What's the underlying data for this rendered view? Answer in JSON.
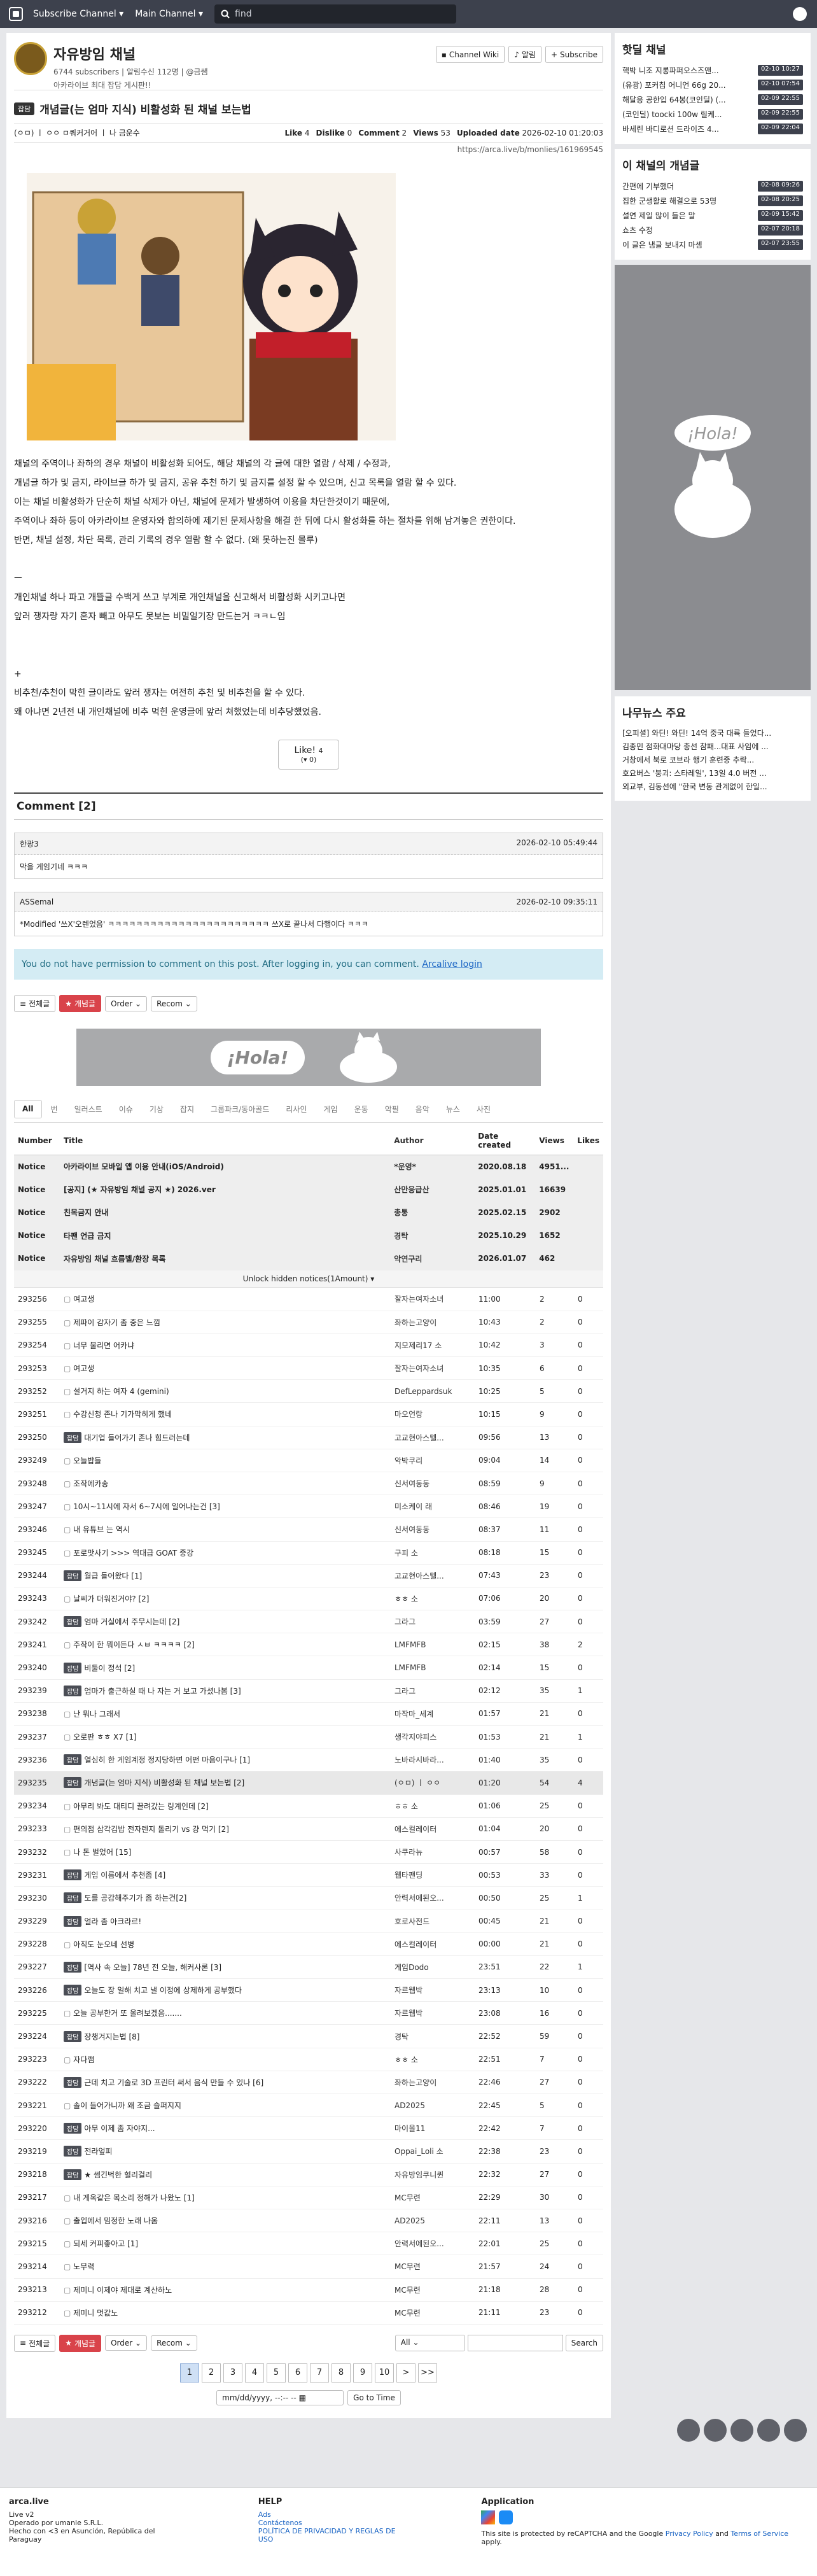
{
  "topbar": {
    "subscribe": "Subscribe Channel ▾",
    "main": "Main Channel ▾",
    "search_placeholder": "find"
  },
  "channel": {
    "name": "자유방임 채널",
    "subscribers": "6744 subscribers",
    "notify": "알림수신 112명",
    "owner": "@금쌤",
    "desc": "아카라이브 최대 잡담 게시판!!",
    "btn_wiki": "Channel Wiki",
    "btn_notify": "알림",
    "btn_subscribe": "Subscribe"
  },
  "article": {
    "badge": "잡담",
    "title": "개념글(는 엄마 지식) 비활성화 된 채널 보는법",
    "author": "(ㅇㅁ) ㅣ ㅇㅇ ㅁ쿼커거어 ㅣ 나 금운수",
    "like_label": "Like",
    "like": "4",
    "dislike_label": "Dislike",
    "dislike": "0",
    "comment_label": "Comment",
    "comment": "2",
    "views_label": "Views",
    "views": "53",
    "uploaded_label": "Uploaded date",
    "uploaded": "2026-02-10 01:20:03",
    "url": "https://arca.live/b/monlies/161969545",
    "body": [
      "채널의 주역이나 좌하의 경우 채널이 비활성화 되어도, 해당 채널의 각 글에 대한 열람 / 삭제 / 수정과,",
      "개념글 하가 및 금지, 라이브글 하가 및 금지, 공유 추천 하기 및 금지를 설정 할 수 있으며, 신고 목록을 열람 할 수 있다.",
      "이는 채널 비활성화가 단순히 채널 삭제가 아닌, 채널에 문제가 발생하여 이용을 차단한것이기 때문에,",
      "주역이나 좌하 등이 아카라이브 운영자와 합의하에 제기된 문제사항을 해결 한 뒤에 다시 활성화를 하는 절차를 위해 남겨놓은 권한이다.",
      "반면, 채널 설정, 차단 목록, 관리 기록의 경우 열람 할 수 없다. (왜 못하는진 몰루)",
      "",
      "ㅡ",
      "개인채널 하나 파고 개뜰글 수백게 쓰고 부계로 개인채널을 신고해서 비활성화 시키고나면",
      "앞러 쟁자랑 자기 혼자 빼고 아무도 못보는 비밀일기장 만드는거 ㅋㅋㄴ임",
      "",
      "",
      "+",
      "비추천/추천이 막힌 글이라도 앞러 쟁자는 여전히 추천 및 비추천을 할 수 있다.",
      "왜 아냐면 2년전 내 개인채널에 비추 먹힌 운영글에 앞러 쳐했었는데 비추당했었음."
    ],
    "like_btn": "Like!",
    "like_count": "4",
    "like_sub": "0"
  },
  "comments": {
    "heading": "Comment [2]",
    "items": [
      {
        "author": "한광3",
        "date": "2026-02-10 05:49:44",
        "text": "막을 게임기네 ㅋㅋㅋ"
      },
      {
        "author": "ASSemal",
        "date": "2026-02-10 09:35:11",
        "text": "*Modified '쓰X'오렌었음' ㅋㅋㅋㅋㅋㅋㅋㅋㅋㅋㅋㅋㅋㅋㅋㅋㅋㅋㅋㅋㅋㅋㅋ 쓰X로 끝나서 다행이다 ㅋㅋㅋ"
      }
    ],
    "no_permission": "You do not have permission to comment on this post. After logging in, you can comment.",
    "login": "Arcalive login"
  },
  "controls": {
    "all": "전체글",
    "best": "개념글",
    "order": "Order",
    "recom": "Recom"
  },
  "ad": {
    "hola": "¡Hola!"
  },
  "categories": [
    "All",
    "번",
    "일러스트",
    "이슈",
    "기상",
    "잡지",
    "그룹파크/동아골드",
    "리사인",
    "게임",
    "운동",
    "악필",
    "음악",
    "뉴스",
    "사진"
  ],
  "board": {
    "headers": {
      "num": "Number",
      "title": "Title",
      "author": "Author",
      "date": "Date created",
      "views": "Views",
      "rec": "Likes"
    },
    "notices": [
      {
        "num": "Notice",
        "title": "아카라이브 모바일 앱 이용 안내(iOS/Android)",
        "author": "*운영*",
        "date": "2020.08.18",
        "views": "4951...",
        "rec": ""
      },
      {
        "num": "Notice",
        "title": "[공지] (★ 자유방임 채널 공지 ★) 2026.ver",
        "author": "산만응급산",
        "date": "2025.01.01",
        "views": "16639",
        "rec": ""
      },
      {
        "num": "Notice",
        "title": "친목금지 안내",
        "author": "총통",
        "date": "2025.02.15",
        "views": "2902",
        "rec": ""
      },
      {
        "num": "Notice",
        "title": "타팬 언급 금지",
        "author": "경탁",
        "date": "2025.10.29",
        "views": "1652",
        "rec": ""
      },
      {
        "num": "Notice",
        "title": "자유방임 채널 흐름벨/환장 목록",
        "author": "악연구리",
        "date": "2026.01.07",
        "views": "462",
        "rec": ""
      }
    ],
    "unlock": "Unlock hidden notices(1Amount)",
    "rows": [
      {
        "num": "293256",
        "tag": "",
        "title": "여고생",
        "author": "잘자는여자소녀",
        "date": "11:00",
        "views": "2",
        "rec": "0"
      },
      {
        "num": "293255",
        "tag": "",
        "title": "제파이 감자기 좀 중은 느낌",
        "author": "좌하는고양이",
        "date": "10:43",
        "views": "2",
        "rec": "0"
      },
      {
        "num": "293254",
        "tag": "",
        "title": "너무 불리면 어카냐",
        "author": "지모제리17 소",
        "date": "10:42",
        "views": "3",
        "rec": "0"
      },
      {
        "num": "293253",
        "tag": "",
        "title": "여고생",
        "author": "잘자는여자소녀",
        "date": "10:35",
        "views": "6",
        "rec": "0"
      },
      {
        "num": "293252",
        "tag": "",
        "title": "설거지 하는 여자 4 (gemini)",
        "author": "DefLeppardsuk",
        "date": "10:25",
        "views": "5",
        "rec": "0"
      },
      {
        "num": "293251",
        "tag": "",
        "title": "수강신청 존나 기가막히게 했네",
        "author": "마오언랑",
        "date": "10:15",
        "views": "9",
        "rec": "0"
      },
      {
        "num": "293250",
        "tag": "잡담",
        "title": "대기업 들어가기 존나 힘드러는데",
        "author": "고교현아스텔...",
        "date": "09:56",
        "views": "13",
        "rec": "0"
      },
      {
        "num": "293249",
        "tag": "",
        "title": "오늘밥들",
        "author": "악박쿠리",
        "date": "09:04",
        "views": "14",
        "rec": "0"
      },
      {
        "num": "293248",
        "tag": "",
        "title": "조작에카송",
        "author": "신서여동동",
        "date": "08:59",
        "views": "9",
        "rec": "0"
      },
      {
        "num": "293247",
        "tag": "",
        "title": "10시~11시에 자서 6~7시에 일어나는건 [3]",
        "author": "미소케이 래",
        "date": "08:46",
        "views": "19",
        "rec": "0"
      },
      {
        "num": "293246",
        "tag": "",
        "title": "내 유튜브 는 역시",
        "author": "신서여동동",
        "date": "08:37",
        "views": "11",
        "rec": "0"
      },
      {
        "num": "293245",
        "tag": "",
        "title": "포로맛사기 >>> 역대급 GOAT 중강",
        "author": "구피 소",
        "date": "08:18",
        "views": "15",
        "rec": "0"
      },
      {
        "num": "293244",
        "tag": "잡담",
        "title": "월급 들어왔다 [1]",
        "author": "고교현아스텔...",
        "date": "07:43",
        "views": "23",
        "rec": "0"
      },
      {
        "num": "293243",
        "tag": "",
        "title": "날씨가 더워진거야? [2]",
        "author": "ㅎㅎ 소",
        "date": "07:06",
        "views": "20",
        "rec": "0"
      },
      {
        "num": "293242",
        "tag": "잡담",
        "title": "엄마 거실에서 주무시는데 [2]",
        "author": "그라그",
        "date": "03:59",
        "views": "27",
        "rec": "0"
      },
      {
        "num": "293241",
        "tag": "",
        "title": "주작이 한 뭐이든다 ㅅㅂ ㅋㅋㅋㅋ [2]",
        "author": "LMFMFB",
        "date": "02:15",
        "views": "38",
        "rec": "2"
      },
      {
        "num": "293240",
        "tag": "잡담",
        "title": "비둘이 정석 [2]",
        "author": "LMFMFB",
        "date": "02:14",
        "views": "15",
        "rec": "0"
      },
      {
        "num": "293239",
        "tag": "잡담",
        "title": "엄마가 출근하실 때 나 자는 거 보고 가셨나봄 [3]",
        "author": "그라그",
        "date": "02:12",
        "views": "35",
        "rec": "1"
      },
      {
        "num": "293238",
        "tag": "",
        "title": "난 뭐나 그래서",
        "author": "마작마_세계",
        "date": "01:57",
        "views": "21",
        "rec": "0"
      },
      {
        "num": "293237",
        "tag": "",
        "title": "오로판 ㅎㅎ X7 [1]",
        "author": "생각지야피스",
        "date": "01:53",
        "views": "21",
        "rec": "1"
      },
      {
        "num": "293236",
        "tag": "잡담",
        "title": "열심히 한 게임계정 정지당하면 어떤 마음이구나 [1]",
        "author": "노바라시바라...",
        "date": "01:40",
        "views": "35",
        "rec": "0"
      },
      {
        "num": "293235",
        "tag": "잡담",
        "title": "개념글(는 엄마 지식) 비활성화 된 채널 보는법 [2]",
        "author": "(ㅇㅁ) ㅣ ㅇㅇ",
        "date": "01:20",
        "views": "54",
        "rec": "4"
      },
      {
        "num": "293234",
        "tag": "",
        "title": "아무리 봐도 대티디 끌려갔는 링계인데 [2]",
        "author": "ㅎㅎ 소",
        "date": "01:06",
        "views": "25",
        "rec": "0"
      },
      {
        "num": "293233",
        "tag": "",
        "title": "편의점 삼각김밥 전자렌지 돌리기 vs 걍 먹기 [2]",
        "author": "에스컬레이터",
        "date": "01:04",
        "views": "20",
        "rec": "0"
      },
      {
        "num": "293232",
        "tag": "",
        "title": "나 돈 벌었어 [15]",
        "author": "사쿠라뉴",
        "date": "00:57",
        "views": "58",
        "rec": "0"
      },
      {
        "num": "293231",
        "tag": "잡담",
        "title": "게임 이름에서 추천좀 [4]",
        "author": "웹타팬딩",
        "date": "00:53",
        "views": "33",
        "rec": "0"
      },
      {
        "num": "293230",
        "tag": "잡담",
        "title": "도를 공감해주기가 좀 하는건[2]",
        "author": "안력서에된오...",
        "date": "00:50",
        "views": "25",
        "rec": "1"
      },
      {
        "num": "293229",
        "tag": "잡담",
        "title": "얼라 좀 아크라르!",
        "author": "호로사전드",
        "date": "00:45",
        "views": "21",
        "rec": "0"
      },
      {
        "num": "293228",
        "tag": "",
        "title": "아직도 눈오네 선병",
        "author": "에스컬레이터",
        "date": "00:00",
        "views": "21",
        "rec": "0"
      },
      {
        "num": "293227",
        "tag": "잡담",
        "title": "[역사 속 오늘] 78년 전 오늘, 해커사론 [3]",
        "author": "게임Dodo",
        "date": "23:51",
        "views": "22",
        "rec": "1"
      },
      {
        "num": "293226",
        "tag": "잡담",
        "title": "오늘도 장 일해 치고 낼 이정에 상제하게 공부했다",
        "author": "자르웹박",
        "date": "23:13",
        "views": "10",
        "rec": "0"
      },
      {
        "num": "293225",
        "tag": "",
        "title": "오늘 공부한거 또 올려보겠음.......",
        "author": "자르웹박",
        "date": "23:08",
        "views": "16",
        "rec": "0"
      },
      {
        "num": "293224",
        "tag": "잡담",
        "title": "장챙겨지는법 [8]",
        "author": "경탁",
        "date": "22:52",
        "views": "59",
        "rec": "0"
      },
      {
        "num": "293223",
        "tag": "",
        "title": "자다깸",
        "author": "ㅎㅎ 소",
        "date": "22:51",
        "views": "7",
        "rec": "0"
      },
      {
        "num": "293222",
        "tag": "잡담",
        "title": "근데 치고 기술로 3D 프린터 써서 음식 만들 수 있나 [6]",
        "author": "좌하는고양이",
        "date": "22:46",
        "views": "27",
        "rec": "0"
      },
      {
        "num": "293221",
        "tag": "",
        "title": "솔이 들어가니까 왜 조금 슬퍼지지",
        "author": "AD2025",
        "date": "22:45",
        "views": "5",
        "rec": "0"
      },
      {
        "num": "293220",
        "tag": "잡담",
        "title": "아무 이제 좀 자야지...",
        "author": "마이올11",
        "date": "22:42",
        "views": "7",
        "rec": "0"
      },
      {
        "num": "293219",
        "tag": "잡담",
        "title": "전라엎피",
        "author": "Oppai_Loli 소",
        "date": "22:38",
        "views": "23",
        "rec": "0"
      },
      {
        "num": "293218",
        "tag": "잡담",
        "title": "★ 썸긴벅한 혈리걸리",
        "author": "자유방임쿠니퀸",
        "date": "22:32",
        "views": "27",
        "rec": "0"
      },
      {
        "num": "293217",
        "tag": "",
        "title": "내 게옥같은 목소리 정해가 나왔노 [1]",
        "author": "MC무련",
        "date": "22:29",
        "views": "30",
        "rec": "0"
      },
      {
        "num": "293216",
        "tag": "",
        "title": "출입에서 밈정한 노래 나옴",
        "author": "AD2025",
        "date": "22:11",
        "views": "13",
        "rec": "0"
      },
      {
        "num": "293215",
        "tag": "",
        "title": "되세 커피좋아고 [1]",
        "author": "안력서에된오...",
        "date": "22:01",
        "views": "25",
        "rec": "0"
      },
      {
        "num": "293214",
        "tag": "",
        "title": "노무력",
        "author": "MC무련",
        "date": "21:57",
        "views": "24",
        "rec": "0"
      },
      {
        "num": "293213",
        "tag": "",
        "title": "제미니 이제야 제대로 계산하노",
        "author": "MC무련",
        "date": "21:18",
        "views": "28",
        "rec": "0"
      },
      {
        "num": "293212",
        "tag": "",
        "title": "제미니 멋값노",
        "author": "MC무련",
        "date": "21:11",
        "views": "23",
        "rec": "0"
      }
    ]
  },
  "bottom": {
    "all_select": "All",
    "search": "Search",
    "pages": [
      "1",
      "2",
      "3",
      "4",
      "5",
      "6",
      "7",
      "8",
      "9",
      "10",
      ">",
      ">>"
    ],
    "date_placeholder": "mm/dd/yyyy, --:-- --",
    "goto": "Go to Time"
  },
  "sidebar": {
    "hot_title": "핫딜 채널",
    "hot": [
      {
        "t": "핵박 니조 지롱파퍼오스즈앤...",
        "tm": "02-10 10:27"
      },
      {
        "t": "(유광) 포커칩 어니언 66g 20...",
        "tm": "02-10 07:54"
      },
      {
        "t": "해달응 공한입 64봉(코인딜) (...",
        "tm": "02-09 22:55"
      },
      {
        "t": "(코인딜) toocki 100w 릴케...",
        "tm": "02-09 22:55"
      },
      {
        "t": "바세린 바디로션 드라이즈 4...",
        "tm": "02-09 22:04"
      }
    ],
    "best_title": "이 채널의 개념글",
    "best": [
      {
        "t": "간편에 기부했더",
        "tm": "02-08 09:26"
      },
      {
        "t": "집한 군생활로 해결으로 53명",
        "tm": "02-08 20:25"
      },
      {
        "t": "설연 제일 많이 들은 말",
        "tm": "02-09 15:42"
      },
      {
        "t": "쇼츠 수정",
        "tm": "02-07 20:18"
      },
      {
        "t": "이 글은 냄글 보내지 마셈",
        "tm": "02-07 23:55"
      }
    ],
    "news_title": "나무뉴스 주요",
    "news": [
      "[오피셜] 와딘! 와딘! 14억 중국 대륙 들었다...",
      "김종민 점화대마당 총선 참패...대표 사임에 ...",
      "거창에서 북로 코브라 행기 훈련중 추락...",
      "호요버스 '붕괴: 스타레일', 13일 4.0 버전 ...",
      "외교부, 김동선에 \"한국 변동 관계없이 한일..."
    ]
  },
  "footer": {
    "brand": "arca.live",
    "version": "Live v2",
    "operated": "Operado por umanle S.R.L.",
    "made": "Hecho con <3 en Asunción, República del Paraguay",
    "help_title": "HELP",
    "help": [
      "Ads",
      "Contáctenos",
      "POLÍTICA DE PRIVACIDAD Y REGLAS DE USO"
    ],
    "app_title": "Application",
    "recaptcha": "This site is protected by reCAPTCHA and the Google",
    "privacy": "Privacy Policy",
    "and": "and",
    "terms": "Terms of Service",
    "apply": "apply."
  }
}
